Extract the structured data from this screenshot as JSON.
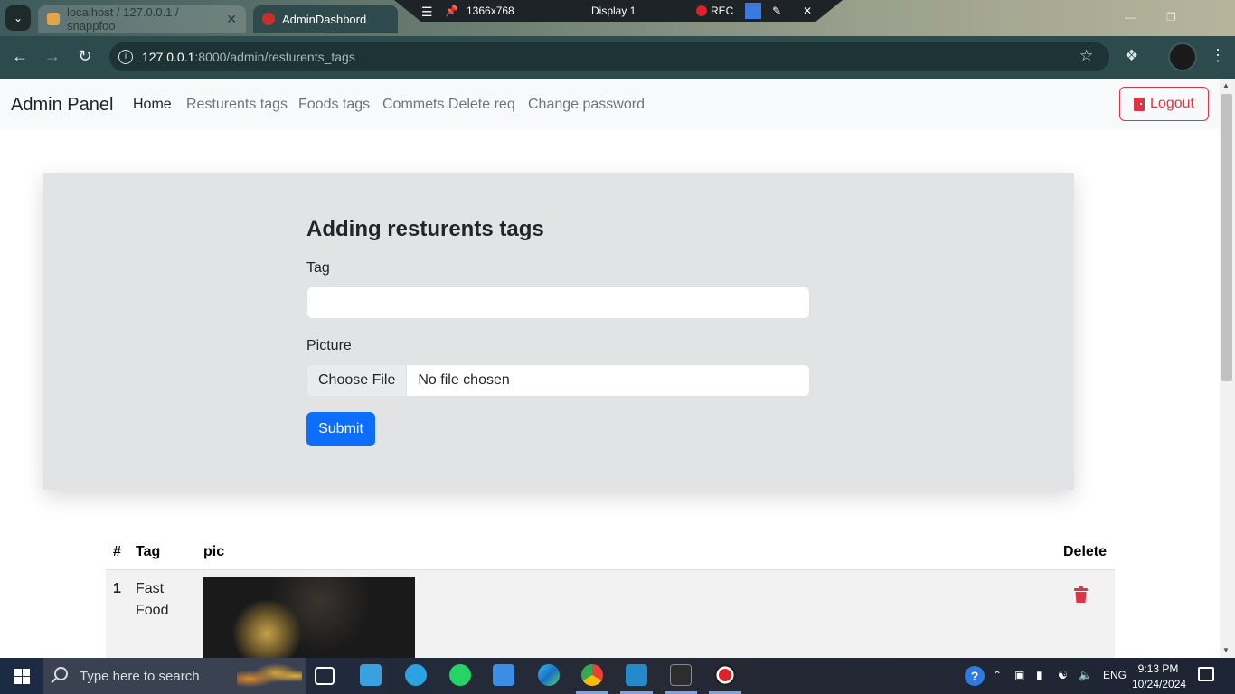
{
  "browser": {
    "tabs": [
      {
        "label": "localhost / 127.0.0.1 / snappfoo",
        "close": "✕"
      },
      {
        "label": "AdminDashbord"
      }
    ],
    "recorder": {
      "resolution": "1366x768",
      "display": "Display 1",
      "rec_label": "REC"
    },
    "url": {
      "host": "127.0.0.1",
      "path": ":8000/admin/resturents_tags"
    }
  },
  "navbar": {
    "brand": "Admin Panel",
    "links": [
      "Home",
      "Resturents tags",
      "Foods tags",
      "Commets Delete req",
      "Change password"
    ],
    "logout_label": "Logout"
  },
  "form": {
    "title": "Adding resturents tags",
    "tag_label": "Tag",
    "tag_value": "",
    "picture_label": "Picture",
    "file_button": "Choose File",
    "file_status": "No file chosen",
    "submit_label": "Submit"
  },
  "table": {
    "headers": {
      "num": "#",
      "tag": "Tag",
      "pic": "pic",
      "delete": "Delete"
    },
    "rows": [
      {
        "num": "1",
        "tag_line1": "Fast",
        "tag_line2": "Food"
      }
    ]
  },
  "taskbar": {
    "search_placeholder": "Type here to search",
    "language": "ENG",
    "time": "9:13 PM",
    "date": "10/24/2024"
  },
  "colors": {
    "primary": "#0d6efd",
    "danger": "#dc3545",
    "card_bg": "#e2e3e5"
  }
}
